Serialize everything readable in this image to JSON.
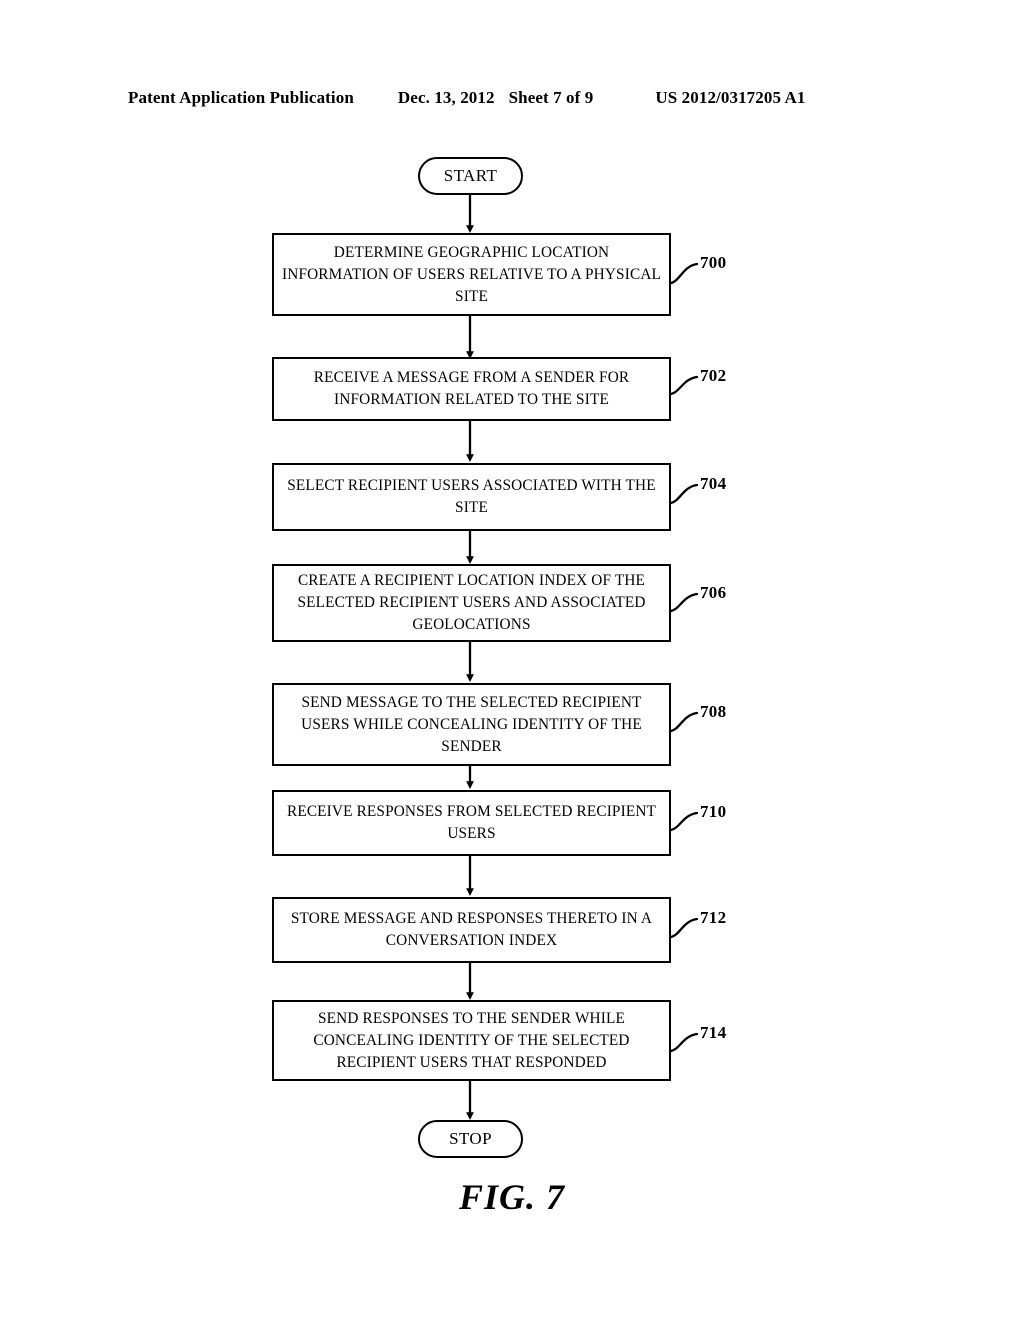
{
  "header": {
    "publication": "Patent Application Publication",
    "date": "Dec. 13, 2012",
    "sheet": "Sheet 7 of 9",
    "document_number": "US 2012/0317205 A1"
  },
  "figure": {
    "caption": "FIG. 7",
    "title_number": "7",
    "type": "flowchart"
  },
  "flowchart": {
    "start_label": "START",
    "stop_label": "STOP",
    "steps": [
      {
        "ref": "700",
        "text": "DETERMINE GEOGRAPHIC LOCATION INFORMATION OF USERS RELATIVE TO A PHYSICAL SITE"
      },
      {
        "ref": "702",
        "text": "RECEIVE A MESSAGE FROM A SENDER FOR INFORMATION RELATED TO THE SITE"
      },
      {
        "ref": "704",
        "text": "SELECT RECIPIENT USERS ASSOCIATED WITH THE SITE"
      },
      {
        "ref": "706",
        "text": "CREATE A RECIPIENT LOCATION INDEX OF THE SELECTED RECIPIENT USERS AND ASSOCIATED GEOLOCATIONS"
      },
      {
        "ref": "708",
        "text": "SEND MESSAGE TO THE SELECTED RECIPIENT USERS WHILE CONCEALING IDENTITY OF THE SENDER"
      },
      {
        "ref": "710",
        "text": "RECEIVE RESPONSES FROM SELECTED RECIPIENT USERS"
      },
      {
        "ref": "712",
        "text": "STORE MESSAGE AND RESPONSES THERETO IN A CONVERSATION INDEX"
      },
      {
        "ref": "714",
        "text": "SEND RESPONSES TO THE SENDER WHILE CONCEALING IDENTITY OF THE SELECTED RECIPIENT USERS THAT RESPONDED"
      }
    ]
  },
  "colors": {
    "ink": "#000000",
    "paper": "#ffffff"
  }
}
